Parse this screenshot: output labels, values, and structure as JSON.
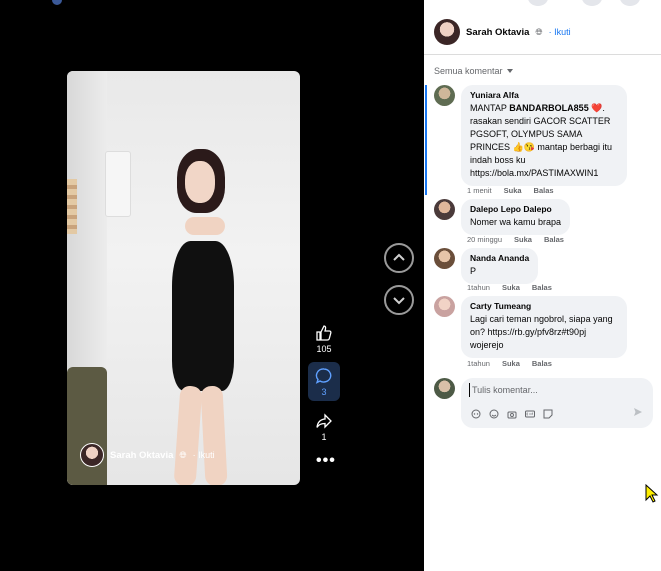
{
  "viewer": {
    "owner_name": "Sarah Oktavia",
    "owner_follow": "· Ikuti",
    "likes": "105",
    "comments": "3",
    "shares": "1",
    "more": "•••"
  },
  "panel": {
    "owner_name": "Sarah Oktavia",
    "owner_follow": "· Ikuti",
    "sort_label": "Semua komentar",
    "comments": [
      {
        "author": "Yuniara Alfa",
        "text_pre": "MANTAP ",
        "text_bold": "BANDARBOLA855",
        "text_post": " ❤️. rasakan sendiri GACOR SCATTER PGSOFT, OLYMPUS SAMA PRINCES 👍😘 mantap berbagi itu indah boss ku https://bola.mx/PASTIMAXWIN1",
        "time": "1 menit",
        "like": "Suka",
        "reply": "Balas"
      },
      {
        "author": "Dalepo Lepo Dalepo",
        "text": "Nomer wa kamu brapa",
        "time": "20 minggu",
        "like": "Suka",
        "reply": "Balas"
      },
      {
        "author": "Nanda Ananda",
        "text": "P",
        "time": "1tahun",
        "like": "Suka",
        "reply": "Balas"
      },
      {
        "author": "Carty Tumeang",
        "text": "Lagi cari teman ngobrol, siapa yang on? https://rb.gy/pfv8rz#t90pj wojerejo",
        "time": "1tahun",
        "like": "Suka",
        "reply": "Balas"
      }
    ],
    "compose_placeholder": "Tulis komentar..."
  },
  "colors": {
    "accent": "#1877f2",
    "bubble": "#f0f2f5",
    "muted": "#65676b"
  }
}
